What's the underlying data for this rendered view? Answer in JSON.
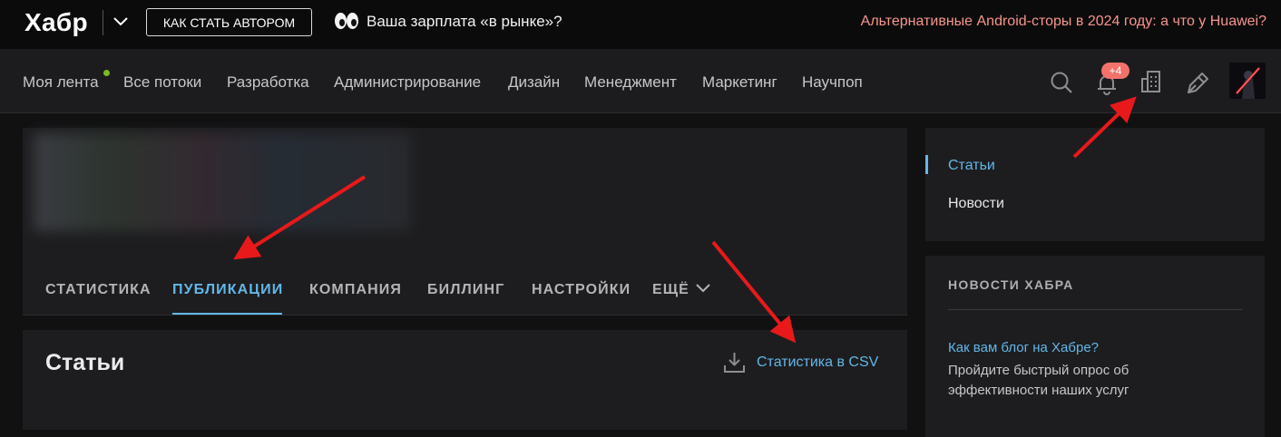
{
  "topbar": {
    "logo": "Хабр",
    "author_button": "КАК СТАТЬ АВТОРОМ",
    "salary_link": "Ваша зарплата «в рынке»?",
    "promo_link": "Альтернативные Android-сторы в 2024 году: а что у Huawei?"
  },
  "nav": {
    "items": [
      "Моя лента",
      "Все потоки",
      "Разработка",
      "Администрирование",
      "Дизайн",
      "Менеджмент",
      "Маркетинг",
      "Научпоп"
    ],
    "notification_badge": "+4"
  },
  "company": {
    "tabs": [
      "СТАТИСТИКА",
      "ПУБЛИКАЦИИ",
      "КОМПАНИЯ",
      "БИЛЛИНГ",
      "НАСТРОЙКИ",
      "ЕЩЁ"
    ],
    "active_tab": "ПУБЛИКАЦИИ"
  },
  "articles": {
    "title": "Статьи",
    "csv_link": "Статистика в CSV"
  },
  "sidebar": {
    "menu": [
      "Статьи",
      "Новости"
    ],
    "news_title": "НОВОСТИ ХАБРА",
    "news_link": "Как вам блог на Хабре?",
    "news_text": "Пройдите быстрый опрос об эффективности наших услуг"
  },
  "colors": {
    "accent": "#63b7e8",
    "promo": "#f7958c",
    "badge": "#f2726a",
    "online_dot": "#7cba28",
    "annotation_arrow": "#e8191b"
  },
  "icons": [
    "chevron-down-icon",
    "eyes-emoji-icon",
    "search-icon",
    "bell-icon",
    "company-building-icon",
    "write-pen-icon",
    "download-icon"
  ]
}
